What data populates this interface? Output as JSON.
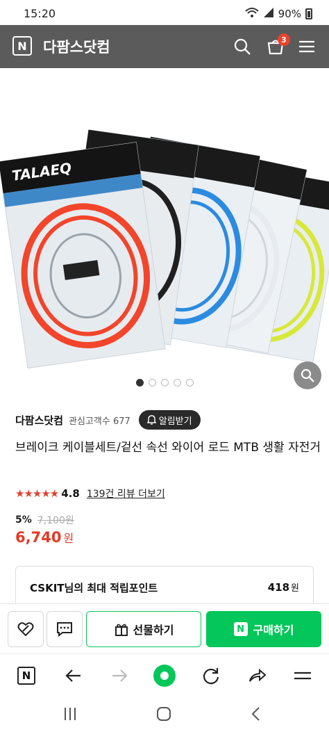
{
  "status_bar": {
    "time": "15:20",
    "battery": "90%"
  },
  "header": {
    "logo_letter": "N",
    "store_name": "다팜스닷컴",
    "cart_count": "3"
  },
  "image": {
    "watermark": "TALAEQ",
    "packages": [
      {
        "cable_color": "#f2452b"
      },
      {
        "cable_color": "#1f1f1f"
      },
      {
        "cable_color": "#2b8be0"
      },
      {
        "cable_color": "#e6ebf0"
      },
      {
        "cable_color": "#d8e83a"
      }
    ],
    "pagination": {
      "count": 5,
      "active_index": 0
    }
  },
  "store": {
    "name": "다팜스닷컴",
    "fans_label": "관심고객수 677",
    "alarm_label": "알림받기"
  },
  "product": {
    "title": "브레이크 케이블세트/겉선 속선 와이어 로드 MTB 생활 자전거",
    "rating_stars": "★★★★★",
    "rating": "4.8",
    "review_link": "139건 리뷰 더보기",
    "discount_rate": "5%",
    "original_price": "7,100원",
    "sale_price": "6,740",
    "sale_unit": "원"
  },
  "points": {
    "label": "CSKIT님의 최대 적립포인트",
    "value": "418",
    "unit": "원"
  },
  "buybar": {
    "gift_label": "선물하기",
    "buy_label": "구매하기",
    "buy_badge": "N"
  },
  "browser_nav": {
    "home_letter": "N"
  },
  "colors": {
    "header_bg": "#5b5b5b",
    "accent_green": "#03c75a",
    "price_red": "#e33b26"
  }
}
